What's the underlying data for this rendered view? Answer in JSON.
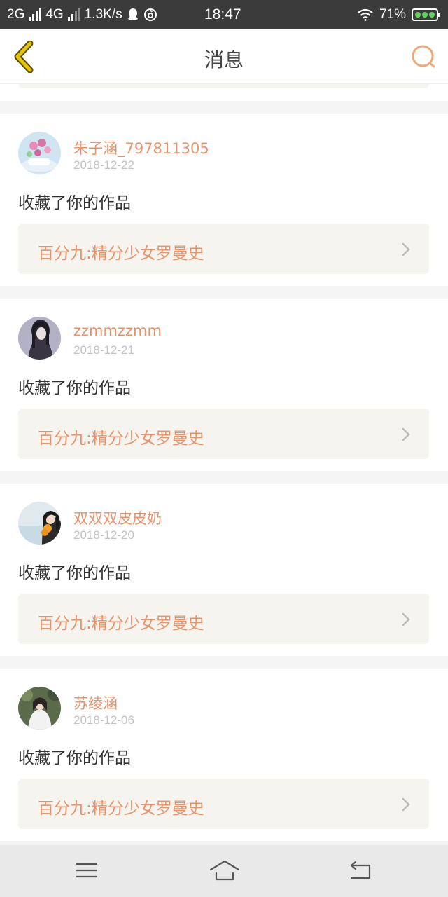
{
  "status_bar": {
    "network1": "2G",
    "network2": "4G",
    "speed": "1.3K/s",
    "time": "18:47",
    "battery": "71%"
  },
  "header": {
    "title": "消息"
  },
  "messages": [
    {
      "user": "朱子涵_797811305",
      "date": "2018-12-22",
      "action": "收藏了你的作品",
      "work": "百分九:精分少女罗曼史"
    },
    {
      "user": "zzmmzzmm",
      "date": "2018-12-21",
      "action": "收藏了你的作品",
      "work": "百分九:精分少女罗曼史"
    },
    {
      "user": "双双双皮皮奶",
      "date": "2018-12-20",
      "action": "收藏了你的作品",
      "work": "百分九:精分少女罗曼史"
    },
    {
      "user": "苏绫涵",
      "date": "2018-12-06",
      "action": "收藏了你的作品",
      "work": "百分九:精分少女罗曼史"
    }
  ],
  "colors": {
    "accent": "#e8936b",
    "back_icon": "#d9b700",
    "card_link_bg": "#f5f4ef"
  }
}
